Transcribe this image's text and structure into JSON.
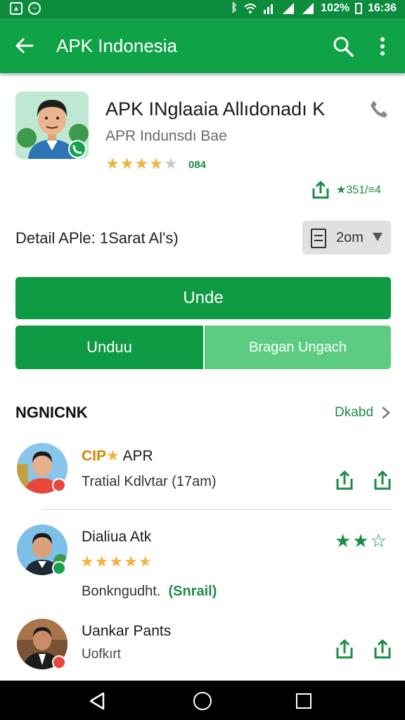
{
  "status_bar": {
    "battery": "102%",
    "time": "16:36"
  },
  "app_bar": {
    "title": "APK Indonesia",
    "back_icon": "arrow-left-icon",
    "search_icon": "search-icon",
    "more_icon": "more-vert-icon"
  },
  "app": {
    "name": "APK INglaaia Allıdonadı K",
    "developer": "APR Indunsdı Bae",
    "stars_filled": 4,
    "stars_total": 5,
    "rating_text": "084",
    "share_count": "★351/≡4"
  },
  "detail": {
    "label": "Detail APle: 1Sarat Al's)",
    "size_label": "2om"
  },
  "buttons": {
    "main": "Unde",
    "left": "Unduu",
    "right": "Bragan Ungach"
  },
  "section": {
    "title": "NGNICNK",
    "link": "Dkabd"
  },
  "items": [
    {
      "tag": "CIP",
      "title": "APR",
      "subtitle": "Tratial Kdlvtar  (17am)"
    },
    {
      "title": "Dialiua Atk",
      "stars_filled": 4.5,
      "subtitle_main": "Bonkngudht.",
      "subtitle_green": "(Snrail)",
      "right_stars_filled": 2,
      "right_stars_total": 3
    },
    {
      "title": "Uankar Pants",
      "subtitle": "Uofkırt"
    }
  ],
  "colors": {
    "status_bar": "#0c8c3c",
    "app_bar": "#10a247",
    "primary_button": "#0f9a44",
    "secondary_button": "#5ccc82",
    "accent_green": "#1d8c45",
    "star": "#f0b23a"
  }
}
